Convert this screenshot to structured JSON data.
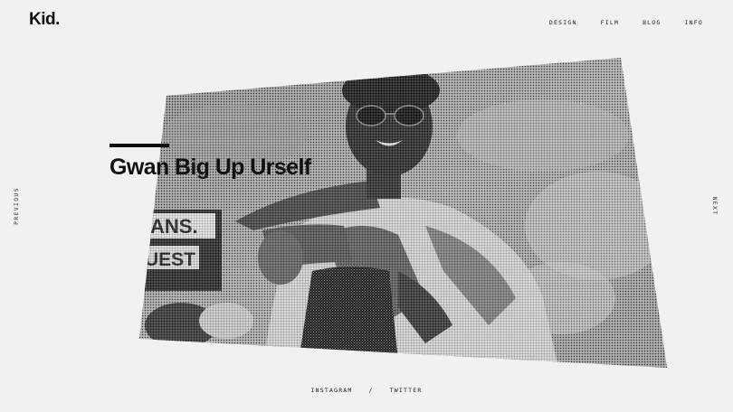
{
  "brand": {
    "logo": "Kid."
  },
  "nav": {
    "items": [
      {
        "label": "DESIGN"
      },
      {
        "label": "FILM"
      },
      {
        "label": "BLOG"
      },
      {
        "label": "INFO"
      }
    ]
  },
  "pager": {
    "previous": "PREVIOUS",
    "next": "NEXT"
  },
  "hero": {
    "title": "Gwan Big Up Urself",
    "sign_text_1": "ANS.",
    "sign_text_2": "UEST"
  },
  "footer": {
    "instagram": "INSTAGRAM",
    "separator": "/",
    "twitter": "TWITTER"
  }
}
